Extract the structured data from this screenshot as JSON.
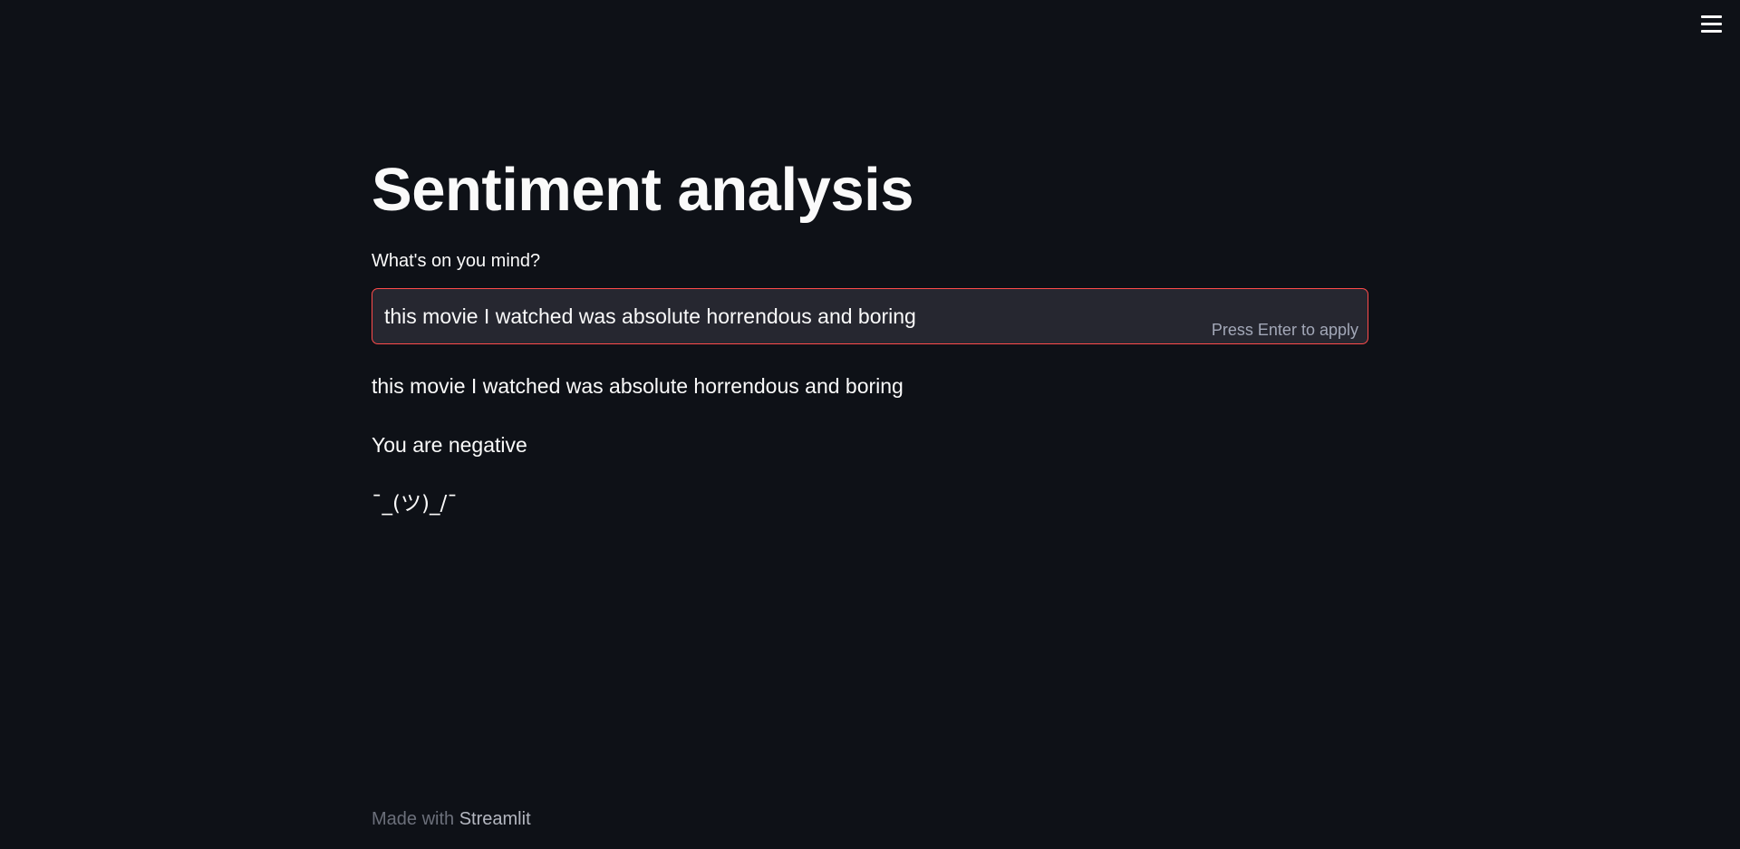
{
  "header": {
    "menu_icon": "hamburger-menu-icon"
  },
  "main": {
    "title": "Sentiment analysis",
    "input_label": "What's on you mind?",
    "input_value": "this movie I watched was absolute horrendous and boring",
    "input_hint": "Press Enter to apply",
    "echo": "this movie I watched was absolute horrendous and boring",
    "result": "You are negative",
    "shrug": "¯_(ツ)_/¯"
  },
  "footer": {
    "prefix": "Made with ",
    "link": "Streamlit"
  },
  "colors": {
    "background": "#0e1117",
    "input_background": "#262730",
    "input_border_focus": "#ff4b4b",
    "text": "#fafafa",
    "muted": "#6b6f7a"
  }
}
